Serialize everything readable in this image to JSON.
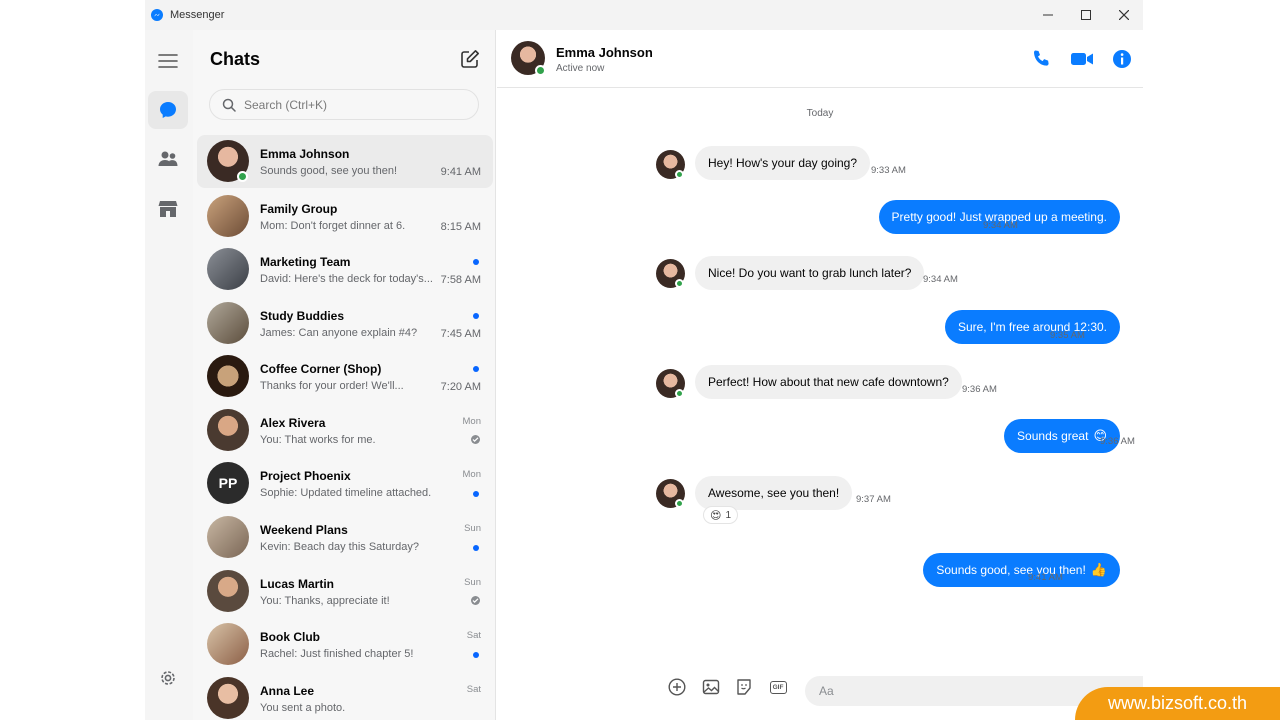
{
  "window": {
    "title": "Messenger"
  },
  "sidebar": {
    "chats_title": "Chats",
    "search_placeholder": "Search (Ctrl+K)"
  },
  "conversations": [
    {
      "name": "Emma Johnson",
      "preview": "Sounds good, see you then!",
      "time": "9:41 AM"
    },
    {
      "name": "Family Group",
      "preview": "Mom: Don't forget dinner at 6.",
      "time": "8:15 AM"
    },
    {
      "name": "Marketing Team",
      "preview": "David: Here's the deck for today's...",
      "time": "7:58 AM"
    },
    {
      "name": "Study Buddies",
      "preview": "James: Can anyone explain #4?",
      "time": "7:45 AM"
    },
    {
      "name": "Coffee Corner (Shop)",
      "preview": "Thanks for your order! We'll...",
      "time": "7:20 AM"
    },
    {
      "name": "Alex Rivera",
      "preview": "You: That works for me.",
      "day": "Mon"
    },
    {
      "name": "Project Phoenix",
      "preview": "Sophie: Updated timeline attached.",
      "day": "Mon",
      "initials": "PP"
    },
    {
      "name": "Weekend Plans",
      "preview": "Kevin: Beach day this Saturday?",
      "day": "Sun"
    },
    {
      "name": "Lucas Martin",
      "preview": "You: Thanks, appreciate it!",
      "day": "Sun"
    },
    {
      "name": "Book Club",
      "preview": "Rachel: Just finished chapter 5!",
      "day": "Sat"
    },
    {
      "name": "Anna Lee",
      "preview": "You sent a photo.",
      "day": "Sat"
    }
  ],
  "header": {
    "name": "Emma Johnson",
    "status": "Active now"
  },
  "thread": {
    "day_label": "Today",
    "messages": [
      {
        "text": "Hey! How's your day going?",
        "time": "9:33 AM"
      },
      {
        "text": "Pretty good! Just wrapped up a meeting.",
        "time": "9:34 AM"
      },
      {
        "text": "Nice! Do you want to grab lunch later?",
        "time": "9:34 AM"
      },
      {
        "text": "Sure, I'm free around 12:30.",
        "time": "9:35 AM"
      },
      {
        "text": "Perfect! How about that new cafe downtown?",
        "time": "9:36 AM"
      },
      {
        "text": "Sounds great",
        "time": "9:36 AM",
        "emoji": "😊"
      },
      {
        "text": "Awesome, see you then!",
        "time": "9:37 AM",
        "reaction_emoji": "😍",
        "reaction_count": "1"
      },
      {
        "text": "Sounds good, see you then!",
        "time": "9:41 AM",
        "emoji": "👍"
      }
    ]
  },
  "composer": {
    "placeholder": "Aa",
    "gif_label": "GIF"
  },
  "watermark": "www.bizsoft.co.th",
  "colors": {
    "accent": "#0a7cff",
    "online": "#31a24c",
    "watermark_bg": "#f39c12"
  }
}
